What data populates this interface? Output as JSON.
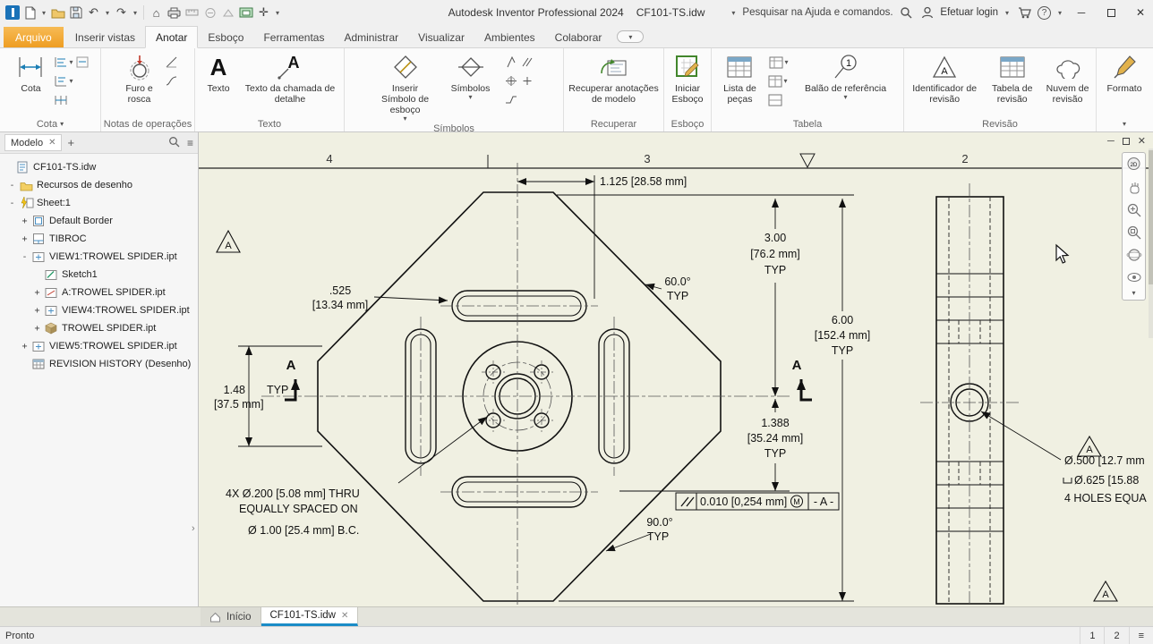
{
  "titlebar": {
    "app_title": "Autodesk Inventor Professional 2024",
    "doc_title": "CF101-TS.idw",
    "search_placeholder": "Pesquisar na Ajuda e comandos.",
    "login_label": "Efetuar login"
  },
  "ribbon": {
    "tabs": [
      {
        "label": "Arquivo"
      },
      {
        "label": "Inserir vistas"
      },
      {
        "label": "Anotar"
      },
      {
        "label": "Esboço"
      },
      {
        "label": "Ferramentas"
      },
      {
        "label": "Administrar"
      },
      {
        "label": "Visualizar"
      },
      {
        "label": "Ambientes"
      },
      {
        "label": "Colaborar"
      }
    ],
    "panels": [
      {
        "label": "Cota",
        "buttons": {
          "cota": "Cota"
        }
      },
      {
        "label": "Notas de operações",
        "buttons": {
          "furo": "Furo e rosca"
        }
      },
      {
        "label": "Texto",
        "buttons": {
          "texto": "Texto",
          "chamada": "Texto da chamada de detalhe"
        }
      },
      {
        "label": "Símbolos",
        "buttons": {
          "inserir": "Inserir Símbolo de esboço",
          "simbolos": "Símbolos"
        }
      },
      {
        "label": "Recuperar",
        "buttons": {
          "recuperar": "Recuperar anotações de modelo"
        }
      },
      {
        "label": "Esboço",
        "buttons": {
          "iniciar": "Iniciar Esboço"
        }
      },
      {
        "label": "Tabela",
        "buttons": {
          "lista": "Lista de peças",
          "balao": "Balão de referência"
        }
      },
      {
        "label": "Revisão",
        "buttons": {
          "ident": "Identificador de revisão",
          "tabela_rev": "Tabela de revisão",
          "nuvem": "Nuvem de revisão"
        }
      },
      {
        "label": "Formato",
        "buttons": {
          "formato": "Formato"
        }
      }
    ]
  },
  "browser": {
    "tab_label": "Modelo",
    "tree": [
      {
        "expander": "",
        "label": "CF101-TS.idw"
      },
      {
        "expander": "-",
        "label": "Recursos de desenho"
      },
      {
        "expander": "-",
        "label": "Sheet:1"
      },
      {
        "expander": "+",
        "label": "Default Border"
      },
      {
        "expander": "+",
        "label": "TIBROC"
      },
      {
        "expander": "-",
        "label": "VIEW1:TROWEL SPIDER.ipt"
      },
      {
        "expander": "",
        "label": "Sketch1"
      },
      {
        "expander": "+",
        "label": "A:TROWEL SPIDER.ipt"
      },
      {
        "expander": "+",
        "label": "VIEW4:TROWEL SPIDER.ipt"
      },
      {
        "expander": "+",
        "label": "TROWEL SPIDER.ipt"
      },
      {
        "expander": "+",
        "label": "VIEW5:TROWEL SPIDER.ipt"
      },
      {
        "expander": "",
        "label": "REVISION HISTORY (Desenho)"
      }
    ]
  },
  "drawing": {
    "zone_labels": [
      "4",
      "3",
      "2"
    ],
    "section_label": "A",
    "datum_label": "A",
    "dim_width_center": "1.125 [28.58 mm]",
    "dim_3in": [
      "3.00",
      "[76.2 mm]",
      "TYP"
    ],
    "dim_6in": [
      "6.00",
      "[152.4 mm]",
      "TYP"
    ],
    "dim_slot": [
      ".525",
      "[13.34 mm]"
    ],
    "dim_60": [
      "60.0°",
      "TYP"
    ],
    "dim_148": [
      "1.48",
      "TYP",
      "[37.5 mm]"
    ],
    "dim_1388": [
      "1.388",
      "[35.24 mm]",
      "TYP"
    ],
    "note_holes": [
      "4X Ø.200 [5.08 mm] THRU",
      "EQUALLY SPACED ON",
      "Ø 1.00 [25.4 mm] B.C."
    ],
    "dim_90": [
      "90.0°",
      "TYP"
    ],
    "fcf": {
      "value": "0.010 [0,254 mm]",
      "modifier": "M",
      "datum": "- A -"
    },
    "side_note": [
      "Ø.500 [12.7 mm",
      "Ø.625 [15.88",
      "4 HOLES EQUA"
    ]
  },
  "doc_tabs": {
    "home_label": "Início",
    "doc_label": "CF101-TS.idw"
  },
  "status": {
    "message": "Pronto",
    "page1": "1",
    "page2": "2"
  }
}
